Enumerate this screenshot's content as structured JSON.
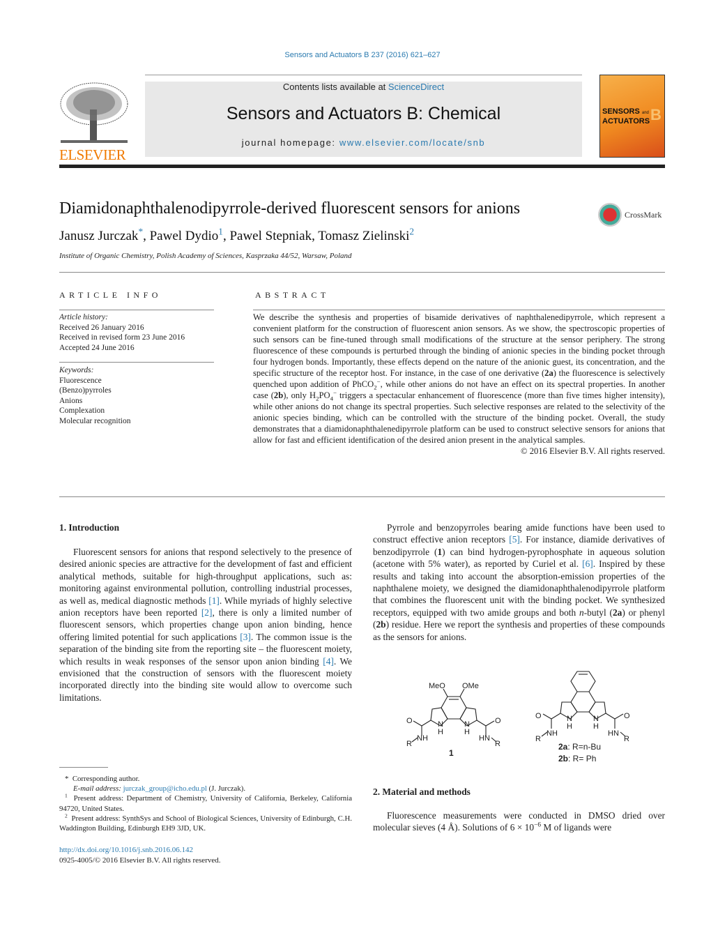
{
  "citation": "Sensors and Actuators B 237 (2016) 621–627",
  "header": {
    "publisher_logo": "ELSEVIER",
    "contents_prefix": "Contents lists available at ",
    "contents_link": "ScienceDirect",
    "journal_title": "Sensors and Actuators B: Chemical",
    "homepage_prefix": "journal homepage: ",
    "homepage_link": "www.elsevier.com/locate/snb",
    "cover_title_1": "SENSORS",
    "cover_title_and": "and",
    "cover_title_2": "ACTUATORS",
    "cover_letter": "B",
    "accent_color": "#f39a2c",
    "link_color": "#2a7aaf"
  },
  "article": {
    "title": "Diamidonaphthalenodipyrrole-derived fluorescent sensors for anions",
    "crossmark": "CrossMark",
    "authors": [
      {
        "name": "Janusz Jurczak",
        "mark": "*"
      },
      {
        "name": "Pawel Dydio",
        "mark": "1"
      },
      {
        "name": "Pawel Stepniak",
        "mark": ""
      },
      {
        "name": "Tomasz Zielinski",
        "mark": "2"
      }
    ],
    "affiliation": "Institute of Organic Chemistry, Polish Academy of Sciences, Kasprzaka 44/52, Warsaw, Poland"
  },
  "article_info": {
    "heading": "ARTICLE INFO",
    "history_label": "Article history:",
    "history": [
      "Received 26 January 2016",
      "Received in revised form 23 June 2016",
      "Accepted 24 June 2016"
    ],
    "keywords_label": "Keywords:",
    "keywords": [
      "Fluorescence",
      "(Benzo)pyrroles",
      "Anions",
      "Complexation",
      "Molecular recognition"
    ]
  },
  "abstract": {
    "heading": "ABSTRACT",
    "p1": "We describe the synthesis and properties of bisamide derivatives of naphthalenedipyrrole, which represent a convenient platform for the construction of fluorescent anion sensors. As we show, the spectroscopic properties of such sensors can be fine-tuned through small modifications of the structure at the sensor periphery. The strong fluorescence of these compounds is perturbed through the binding of anionic species in the binding pocket through four hydrogen bonds. Importantly, these effects depend on the nature of the anionic guest, its concentration, and the specific structure of the receptor host. For instance, in the case of one derivative (",
    "c2a": "2a",
    "p2": ") the fluorescence is selectively quenched upon addition of PhCO",
    "p3": ", while other anions do not have an effect on its spectral properties. In another case (",
    "c2b": "2b",
    "p4": "), only H",
    "p5": "PO",
    "p6": " triggers a spectacular enhancement of fluorescence (more than five times higher intensity), while other anions do not change its spectral properties. Such selective responses are related to the selectivity of the anionic species binding, which can be controlled with the structure of the binding pocket. Overall, the study demonstrates that a diamidonaphthalenedipyrrole platform can be used to construct selective sensors for anions that allow for fast and efficient identification of the desired anion present in the analytical samples.",
    "copyright": "© 2016 Elsevier B.V. All rights reserved."
  },
  "intro": {
    "heading": "1.  Introduction",
    "t1": "Fluorescent sensors for anions that respond selectively to the presence of desired anionic species are attractive for the development of fast and efficient analytical methods, suitable for high-throughput applications, such as: monitoring against environmental pollution, controlling industrial processes, as well as, medical diagnostic methods ",
    "r1": "[1]",
    "t2": ". While myriads of highly selective anion receptors have been reported ",
    "r2": "[2]",
    "t3": ", there is only a limited number of fluorescent sensors, which properties change upon anion binding, hence offering limited potential for such applications ",
    "r3": "[3]",
    "t4": ". The common issue is the separation of the binding site from the reporting site – the fluorescent moiety, which results in weak responses of the sensor upon anion binding ",
    "r4": "[4]",
    "t5": ". We envisioned that the construction of sensors with the fluorescent moiety incorporated directly into the binding site would allow to overcome such limitations."
  },
  "right_col": {
    "t1": "Pyrrole and benzopyrroles bearing amide functions have been used to construct effective anion receptors ",
    "r5": "[5]",
    "t2": ". For instance, diamide derivatives of benzodipyrrole (",
    "c1": "1",
    "t3": ") can bind hydrogen-pyrophosphate in aqueous solution (acetone with 5% water), as reported by Curiel et al. ",
    "r6": "[6]",
    "t4": ". Inspired by these results and taking into account the absorption-emission properties of the naphthalene moiety, we designed the diamidonaphthalenodipyrrole platform that combines the fluorescent unit with the binding pocket. We synthesized receptors, equipped with two amide groups and both ",
    "nbutyl": "n",
    "t5": "-butyl (",
    "c2a": "2a",
    "t6": ") or phenyl (",
    "c2b": "2b",
    "t7": ") residue. Here we report the synthesis and properties of these compounds as the sensors for anions."
  },
  "scheme": {
    "c1_labels": {
      "meo": "MeO",
      "ome": "OMe",
      "o": "O",
      "n_h": "N",
      "h": "H",
      "nh": "NH",
      "hn": "HN",
      "r": "R",
      "id": "1"
    },
    "c2_labels": {
      "legend_a_id": "2a",
      "legend_a": ": R=n-Bu",
      "legend_b_id": "2b",
      "legend_b": ": R= Ph"
    }
  },
  "methods": {
    "heading": "2.  Material and methods",
    "t1": "Fluorescence measurements were conducted in DMSO dried over molecular sieves (4 Å). Solutions of 6 × 10",
    "exp": "−6",
    "t2": " M of ligands were"
  },
  "footnotes": {
    "corr_mark": "*",
    "corr": "Corresponding author.",
    "email_label": "E-mail address: ",
    "email": "jurczak_group@icho.edu.pl",
    "email_suffix": " (J. Jurczak).",
    "fn1_mark": "1",
    "fn1": "Present address: Department of Chemistry, University of California, Berkeley, California 94720, United States.",
    "fn2_mark": "2",
    "fn2": "Present address: SynthSys and School of Biological Sciences, University of Edinburgh, C.H. Waddington Building, Edinburgh EH9 3JD, UK."
  },
  "doi": "http://dx.doi.org/10.1016/j.snb.2016.06.142",
  "issn": "0925-4005/© 2016 Elsevier B.V. All rights reserved."
}
